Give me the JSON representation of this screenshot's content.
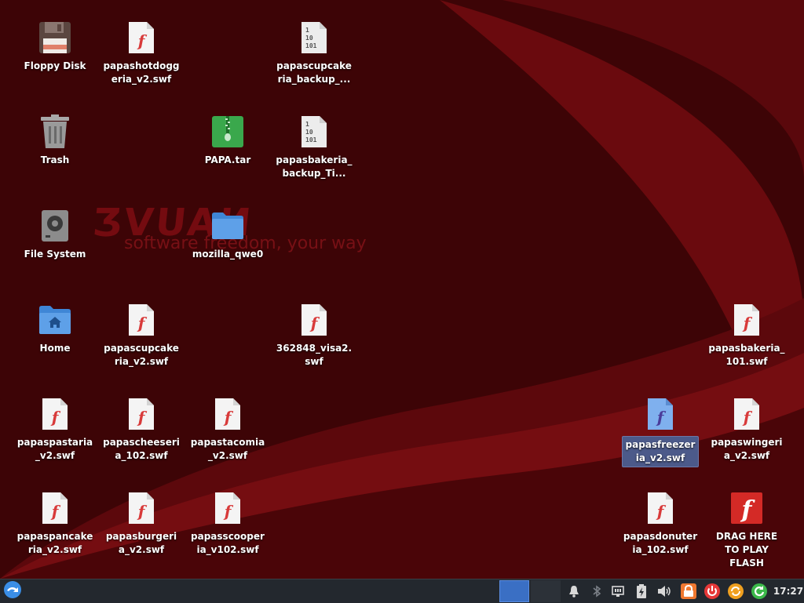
{
  "wallpaper": {
    "logo_text": "ƷVUAИ",
    "tagline": "software freedom, your way",
    "colors": {
      "base": "#3d0406",
      "swoosh": "#6a0a0e",
      "swoosh_light": "#8a1216"
    }
  },
  "desktop_icons": [
    {
      "id": "floppy-disk",
      "label": "Floppy Disk",
      "icon": "floppy-disk-icon"
    },
    {
      "id": "papashotdoggeria",
      "label": "papashotdoggeria_v2.swf",
      "icon": "flash-file-icon"
    },
    {
      "id": "papascupcakeria-backup",
      "label": "papascupcakeria_backup_...",
      "icon": "binary-file-icon"
    },
    {
      "id": "trash",
      "label": "Trash",
      "icon": "trash-icon"
    },
    {
      "id": "papa-tar",
      "label": "PAPA.tar",
      "icon": "archive-icon"
    },
    {
      "id": "papasbakeria-backup",
      "label": "papasbakeria_backup_Ti...",
      "icon": "binary-file-icon"
    },
    {
      "id": "file-system",
      "label": "File System",
      "icon": "hard-drive-icon"
    },
    {
      "id": "mozilla-qwe0",
      "label": "mozilla_qwe0",
      "icon": "folder-icon"
    },
    {
      "id": "home",
      "label": "Home",
      "icon": "home-folder-icon"
    },
    {
      "id": "papascupcakeria",
      "label": "papascupcakeria_v2.swf",
      "icon": "flash-file-icon"
    },
    {
      "id": "visa2",
      "label": "362848_visa2.swf",
      "icon": "flash-file-icon"
    },
    {
      "id": "papasbakeria-101",
      "label": "papasbakeria_101.swf",
      "icon": "flash-file-icon"
    },
    {
      "id": "papaspastaria",
      "label": "papaspastaria_v2.swf",
      "icon": "flash-file-icon"
    },
    {
      "id": "papascheeseria",
      "label": "papascheeseria_102.swf",
      "icon": "flash-file-icon"
    },
    {
      "id": "papastacomia",
      "label": "papastacomia_v2.swf",
      "icon": "flash-file-icon"
    },
    {
      "id": "papasfreezeria",
      "label": "papasfreezeria_v2.swf",
      "icon": "flash-file-icon",
      "selected": true
    },
    {
      "id": "papaswingeria",
      "label": "papaswingeria_v2.swf",
      "icon": "flash-file-icon"
    },
    {
      "id": "papaspancakeria",
      "label": "papaspancakeria_v2.swf",
      "icon": "flash-file-icon"
    },
    {
      "id": "papasburgeria",
      "label": "papasburgeria_v2.swf",
      "icon": "flash-file-icon"
    },
    {
      "id": "papasscooperia",
      "label": "papasscooperia_v102.swf",
      "icon": "flash-file-icon"
    },
    {
      "id": "papasdonuteria",
      "label": "papasdonuteria_102.swf",
      "icon": "flash-file-icon"
    },
    {
      "id": "drag-here-flash",
      "label": "DRAG HERE TO PLAY FLASH",
      "icon": "flash-player-icon"
    }
  ],
  "taskbar": {
    "menu_icon": "zorin-menu-icon",
    "workspaces": [
      "workspace-1",
      "workspace-2"
    ],
    "tray": [
      "bell-icon",
      "bluetooth-icon",
      "network-icon",
      "battery-icon",
      "volume-icon",
      "lock-icon",
      "power-icon",
      "update-icon",
      "refresh-icon"
    ],
    "clock": "17:27"
  }
}
